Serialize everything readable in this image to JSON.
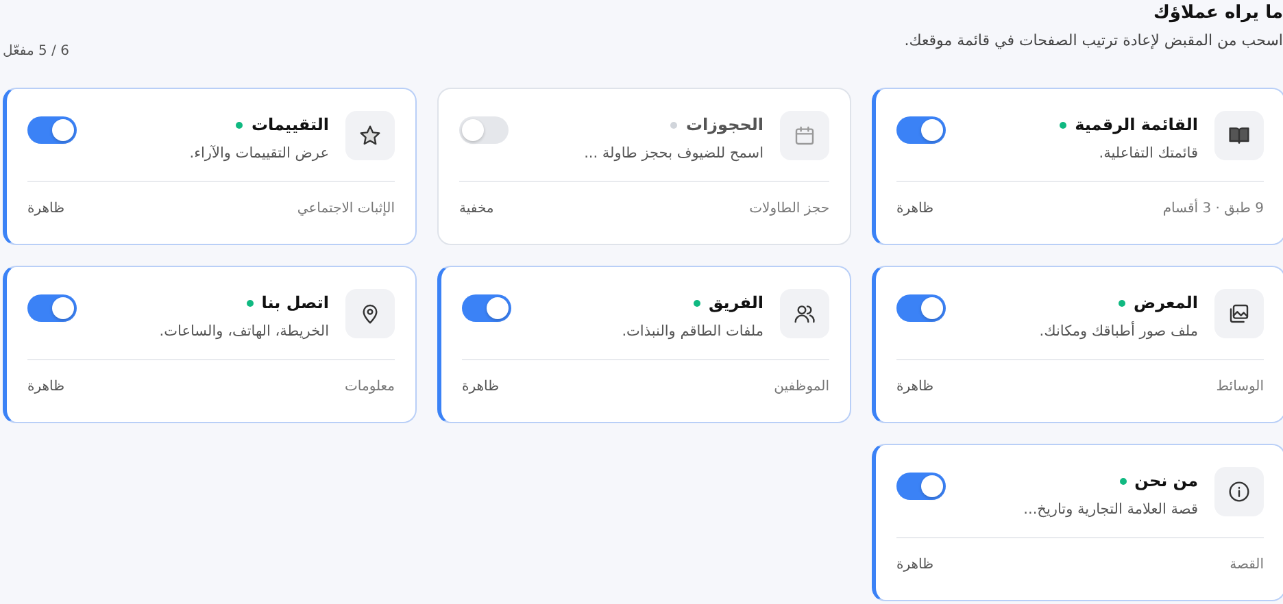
{
  "header": {
    "title": "ما يراه عملاؤك",
    "subtitle": "اسحب من المقبض لإعادة ترتيب الصفحات في قائمة موقعك.",
    "count": "6 / 5 مفعّل"
  },
  "sections": [
    {
      "kind": "book",
      "title": "القائمة الرقمية",
      "description": "قائمتك التفاعلية.",
      "enabled": true,
      "category": "9 طبق · 3 أقسام",
      "status": "ظاهرة"
    },
    {
      "kind": "calendar",
      "title": "الحجوزات",
      "description": "اسمح للضيوف بحجز طاولة ...",
      "enabled": false,
      "category": "حجز الطاولات",
      "status": "مخفية"
    },
    {
      "kind": "star",
      "title": "التقييمات",
      "description": "عرض التقييمات والآراء.",
      "enabled": true,
      "category": "الإثبات الاجتماعي",
      "status": "ظاهرة"
    },
    {
      "kind": "gallery",
      "title": "المعرض",
      "description": "ملف صور أطباقك ومكانك.",
      "enabled": true,
      "category": "الوسائط",
      "status": "ظاهرة"
    },
    {
      "kind": "people",
      "title": "الفريق",
      "description": "ملفات الطاقم والنبذات.",
      "enabled": true,
      "category": "الموظفين",
      "status": "ظاهرة"
    },
    {
      "kind": "pin",
      "title": "اتصل بنا",
      "description": "الخريطة، الهاتف، والساعات.",
      "enabled": true,
      "category": "معلومات",
      "status": "ظاهرة"
    },
    {
      "kind": "info",
      "title": "من نحن",
      "description": "قصة العلامة التجارية وتاريخ...",
      "enabled": true,
      "category": "القصة",
      "status": "ظاهرة"
    }
  ]
}
